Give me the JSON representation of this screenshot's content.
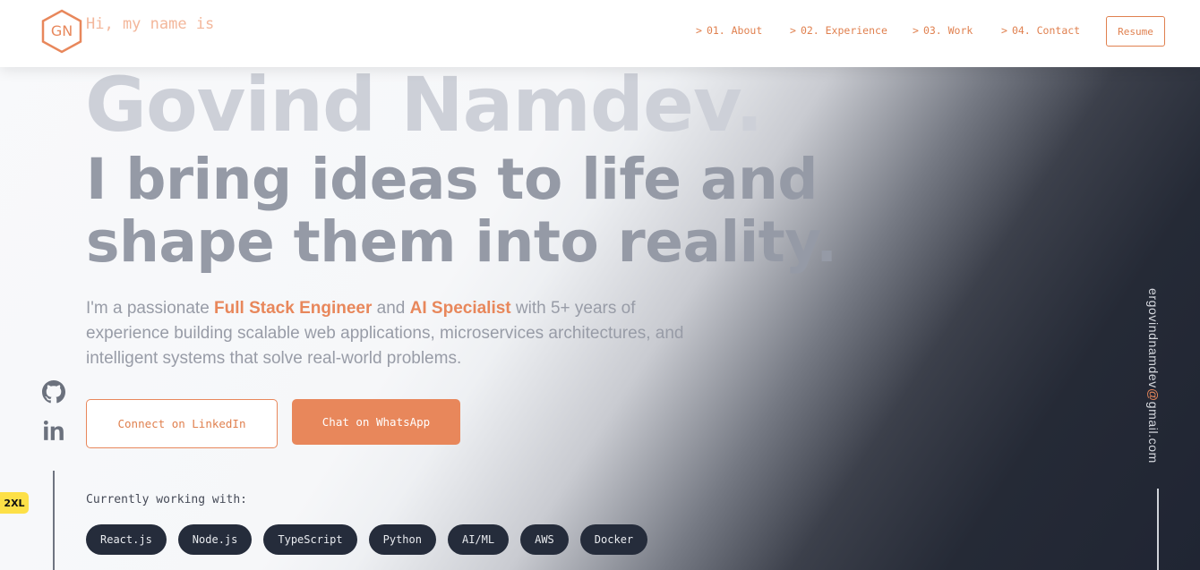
{
  "header": {
    "logo_text": "GN",
    "greeting": "Hi, my name is",
    "nav": [
      {
        "caret": ">",
        "label": "01. About"
      },
      {
        "caret": ">",
        "label": "02. Experience"
      },
      {
        "caret": ">",
        "label": "03. Work"
      },
      {
        "caret": ">",
        "label": "04. Contact"
      }
    ],
    "resume_label": "Resume"
  },
  "hero": {
    "name": "Govind Namdev.",
    "headline_line1": "I bring ideas to life and",
    "headline_line2": "shape them into reality.",
    "intro_part1": "I'm a passionate ",
    "intro_highlight1": "Full Stack Engineer",
    "intro_part2": " and ",
    "intro_highlight2": "AI Specialist",
    "intro_part3": " with 5+ years of experience building scalable web applications, microservices architectures, and intelligent systems that solve real-world problems.",
    "cta_linkedin": "Connect on LinkedIn",
    "cta_whatsapp": "Chat on WhatsApp"
  },
  "tech": {
    "label": "Currently working with:",
    "items": [
      "React.js",
      "Node.js",
      "TypeScript",
      "Python",
      "AI/ML",
      "AWS",
      "Docker"
    ]
  },
  "social": [
    {
      "icon": "github-icon"
    },
    {
      "icon": "linkedin-icon"
    }
  ],
  "email": {
    "user": "ergovindnamdev",
    "at": "@",
    "domain": "gmail.com"
  },
  "screen_badge": "2XL",
  "colors": {
    "accent": "#e8875b",
    "chip_bg": "#252c3b",
    "name_text": "#cdd0d8",
    "headline_text": "#959aa6",
    "badge": "#fde047"
  }
}
